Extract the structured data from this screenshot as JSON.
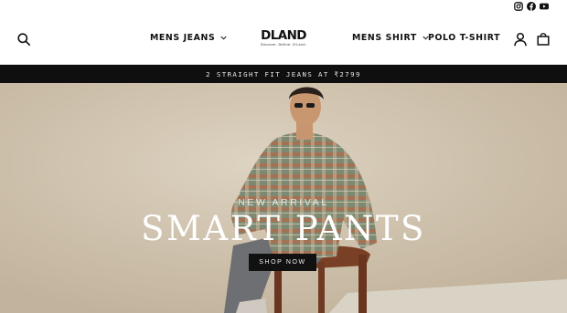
{
  "social": {
    "items": [
      {
        "icon": "instagram-icon"
      },
      {
        "icon": "facebook-icon"
      },
      {
        "icon": "youtube-icon"
      }
    ]
  },
  "header": {
    "logo": {
      "text": "DLAND",
      "tagline": "Discover. Define. D'Land."
    },
    "nav": [
      {
        "label": "MENS JEANS",
        "has_dropdown": true
      },
      {
        "label": "MENS SHIRT",
        "has_dropdown": true
      },
      {
        "label": "POLO T-SHIRT",
        "has_dropdown": false
      }
    ],
    "icons": {
      "search": "search-icon",
      "account": "user-icon",
      "cart": "bag-icon"
    }
  },
  "announcement": {
    "text": "2 STRAIGHT FIT JEANS AT ₹2799"
  },
  "hero": {
    "kicker": "NEW ARRIVAL",
    "title": "SMART PANTS",
    "cta": "SHOP NOW",
    "colors": {
      "backdrop": "#d2c6b2",
      "cta_bg": "#111111",
      "title": "#ffffff"
    }
  }
}
